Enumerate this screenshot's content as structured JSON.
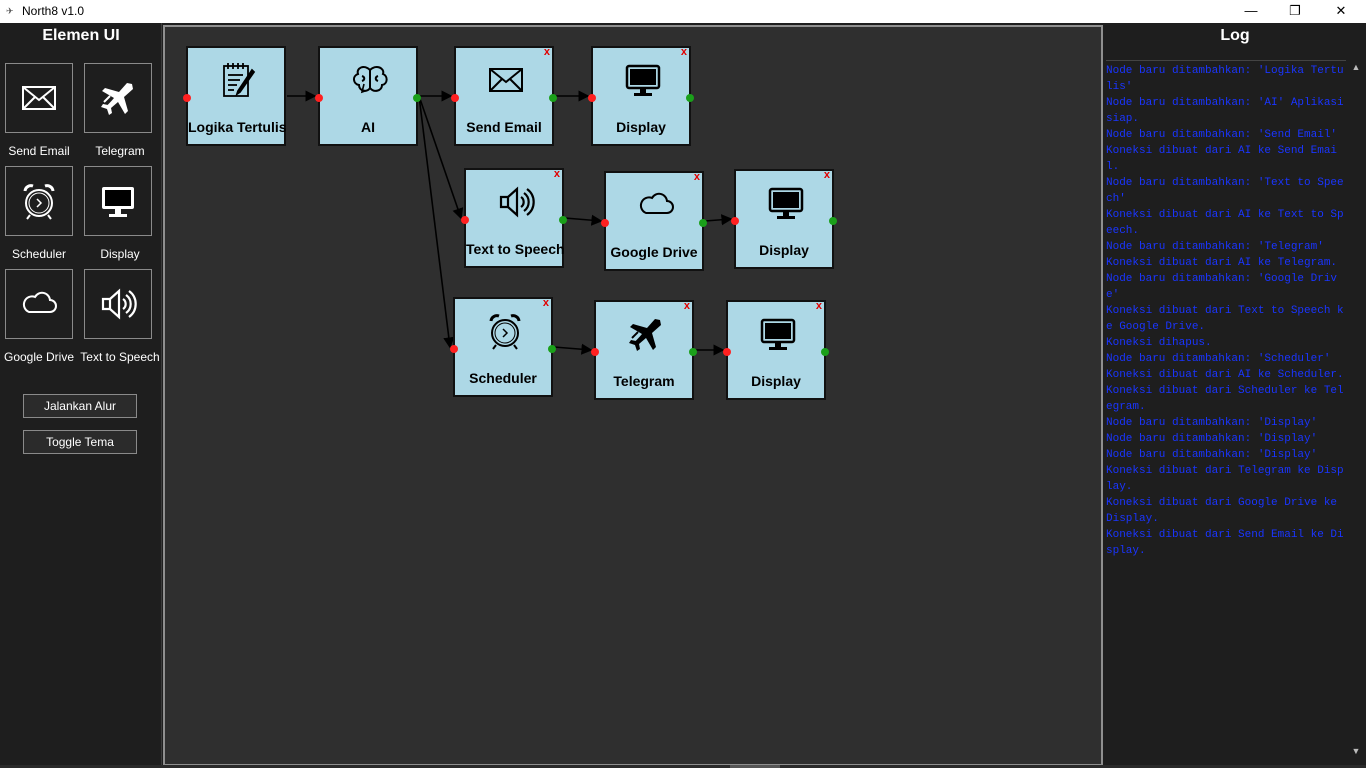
{
  "window": {
    "title": "North8 v1.0",
    "minimize": "—",
    "maximize": "❐",
    "close": "✕"
  },
  "sidebar": {
    "heading": "Elemen UI",
    "items": [
      {
        "label": "Send Email",
        "icon": "envelope-icon"
      },
      {
        "label": "Telegram",
        "icon": "airplane-icon"
      },
      {
        "label": "Scheduler",
        "icon": "alarm-clock-icon"
      },
      {
        "label": "Display",
        "icon": "monitor-icon"
      },
      {
        "label": "Google Drive",
        "icon": "cloud-icon"
      },
      {
        "label": "Text to Speech",
        "icon": "speaker-icon"
      }
    ],
    "run_button": "Jalankan Alur",
    "theme_button": "Toggle Tema"
  },
  "canvas": {
    "nodes": [
      {
        "id": "n1",
        "label": "Logika Tertulis",
        "icon": "notepad-icon",
        "closable": false
      },
      {
        "id": "n2",
        "label": "AI",
        "icon": "brain-icon",
        "closable": false
      },
      {
        "id": "n3",
        "label": "Send Email",
        "icon": "envelope-icon",
        "closable": true
      },
      {
        "id": "n4",
        "label": "Display",
        "icon": "monitor-icon",
        "closable": true
      },
      {
        "id": "n5",
        "label": "Text to Speech",
        "icon": "speaker-icon",
        "closable": true
      },
      {
        "id": "n6",
        "label": "Google Drive",
        "icon": "cloud-icon",
        "closable": true
      },
      {
        "id": "n7",
        "label": "Display",
        "icon": "monitor-icon",
        "closable": true
      },
      {
        "id": "n8",
        "label": "Scheduler",
        "icon": "alarm-clock-icon",
        "closable": true
      },
      {
        "id": "n9",
        "label": "Telegram",
        "icon": "airplane-icon",
        "closable": true
      },
      {
        "id": "n10",
        "label": "Display",
        "icon": "monitor-icon",
        "closable": true
      }
    ],
    "close_glyph": "x",
    "connections": [
      [
        "n1",
        "n2"
      ],
      [
        "n2",
        "n3"
      ],
      [
        "n3",
        "n4"
      ],
      [
        "n2",
        "n5"
      ],
      [
        "n5",
        "n6"
      ],
      [
        "n6",
        "n7"
      ],
      [
        "n2",
        "n8"
      ],
      [
        "n8",
        "n9"
      ],
      [
        "n9",
        "n10"
      ]
    ]
  },
  "log": {
    "heading": "Log",
    "lines": [
      "Node baru ditambahkan: 'Logika Tertulis'",
      "Node baru ditambahkan: 'AI' Aplikasi siap.",
      "Node baru ditambahkan: 'Send Email'",
      "Koneksi dibuat dari AI ke Send Email.",
      "Node baru ditambahkan: 'Text to Speech'",
      "Koneksi dibuat dari AI ke Text to Speech.",
      "Node baru ditambahkan: 'Telegram'",
      "Koneksi dibuat dari AI ke Telegram.",
      "Node baru ditambahkan: 'Google Drive'",
      "Koneksi dibuat dari Text to Speech ke Google Drive.",
      "Koneksi dihapus.",
      "Node baru ditambahkan: 'Scheduler'",
      "Koneksi dibuat dari AI ke Scheduler.",
      "Koneksi dibuat dari Scheduler ke Telegram.",
      "Node baru ditambahkan: 'Display'",
      "Node baru ditambahkan: 'Display'",
      "Node baru ditambahkan: 'Display'",
      "Koneksi dibuat dari Telegram ke Display.",
      "Koneksi dibuat dari Google Drive ke Display.",
      "Koneksi dibuat dari Send Email ke Display."
    ]
  },
  "colors": {
    "node_fill": "#add8e6",
    "port_in": "#ff2020",
    "port_out": "#1aa01a",
    "log_text": "#1a35ff",
    "close_x": "#e00000"
  }
}
